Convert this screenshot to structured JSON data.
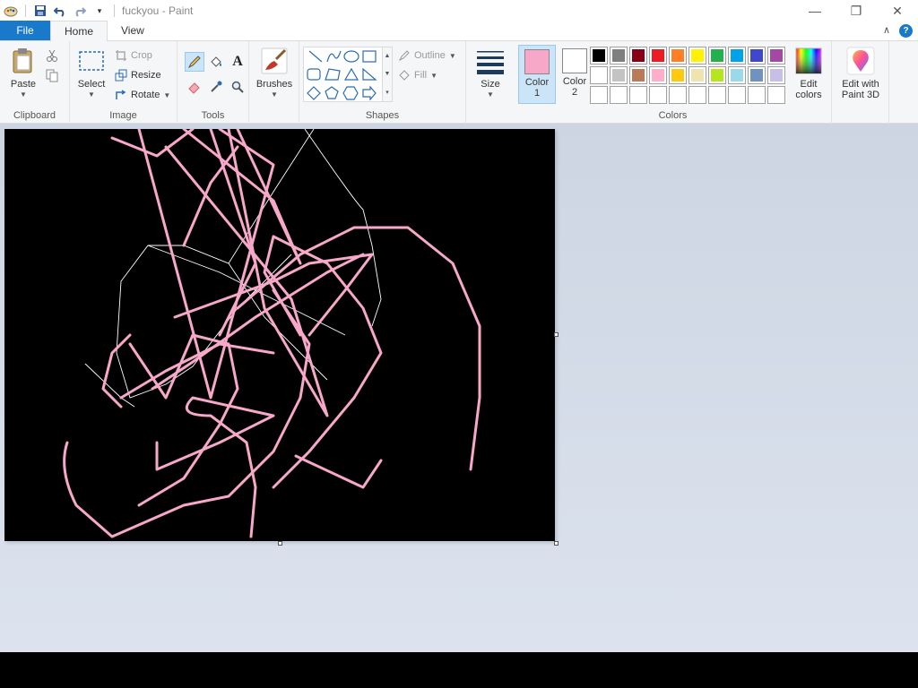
{
  "title": "fuckyou - Paint",
  "tabs": {
    "file": "File",
    "home": "Home",
    "view": "View"
  },
  "clipboard": {
    "paste": "Paste",
    "label": "Clipboard"
  },
  "image": {
    "select": "Select",
    "crop": "Crop",
    "resize": "Resize",
    "rotate": "Rotate",
    "label": "Image"
  },
  "tools": {
    "label": "Tools"
  },
  "brushes": {
    "label": "Brushes"
  },
  "shapes": {
    "outline": "Outline",
    "fill": "Fill",
    "label": "Shapes"
  },
  "size": {
    "label": "Size"
  },
  "colors": {
    "color1_label": "Color",
    "color1_num": "1",
    "color2_label": "Color",
    "color2_num": "2",
    "color1": "#f7a8c9",
    "color2": "#ffffff",
    "edit_colors": "Edit colors",
    "label": "Colors",
    "palette": [
      "#000000",
      "#7f7f7f",
      "#880015",
      "#ed1c24",
      "#ff7f27",
      "#fff200",
      "#22b14c",
      "#00a2e8",
      "#3f48cc",
      "#a349a4",
      "#ffffff",
      "#c3c3c3",
      "#b97a57",
      "#ffaec9",
      "#ffc90e",
      "#efe4b0",
      "#b5e61d",
      "#99d9ea",
      "#7092be",
      "#c8bfe7",
      "#ffffff",
      "#ffffff",
      "#ffffff",
      "#ffffff",
      "#ffffff",
      "#ffffff",
      "#ffffff",
      "#ffffff",
      "#ffffff",
      "#ffffff"
    ]
  },
  "paint3d": {
    "label": "Edit with Paint 3D"
  },
  "canvas": {
    "background": "#000000",
    "big_text": "",
    "small_text": "",
    "big_text_color": "#ffffff",
    "small_text_color": "#f7a8c9",
    "scribble_color": "#f7a8c9"
  }
}
